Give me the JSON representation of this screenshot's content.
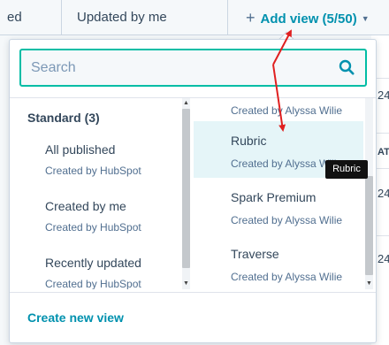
{
  "tabs": {
    "prev_label": "ed",
    "updated_label": "Updated by me"
  },
  "add_view": {
    "label": "Add view (5/50)",
    "plus": "+",
    "caret": "▼"
  },
  "background_fragments": [
    "24",
    "AT",
    "24",
    "24"
  ],
  "search": {
    "placeholder": "Search",
    "value": ""
  },
  "standard_group": {
    "title": "Standard (3)",
    "items": [
      {
        "name": "All published",
        "creator": "Created by HubSpot"
      },
      {
        "name": "Created by me",
        "creator": "Created by HubSpot"
      },
      {
        "name": "Recently updated",
        "creator": "Created by HubSpot"
      }
    ]
  },
  "custom_views": {
    "items": [
      {
        "name": "",
        "creator": "Created by Alyssa Wilie"
      },
      {
        "name": "Rubric",
        "creator": "Created by Alyssa Wilie"
      },
      {
        "name": "Spark Premium",
        "creator": "Created by Alyssa Wilie"
      },
      {
        "name": "Traverse",
        "creator": "Created by Alyssa Wilie"
      }
    ],
    "highlighted_index": 1
  },
  "tooltip": {
    "text": "Rubric"
  },
  "footer": {
    "create_label": "Create new view"
  },
  "colors": {
    "accent": "#0091ae",
    "focus_border": "#00bda5",
    "highlight_bg": "#e5f5f8",
    "annotation_arrow": "#e02020"
  }
}
